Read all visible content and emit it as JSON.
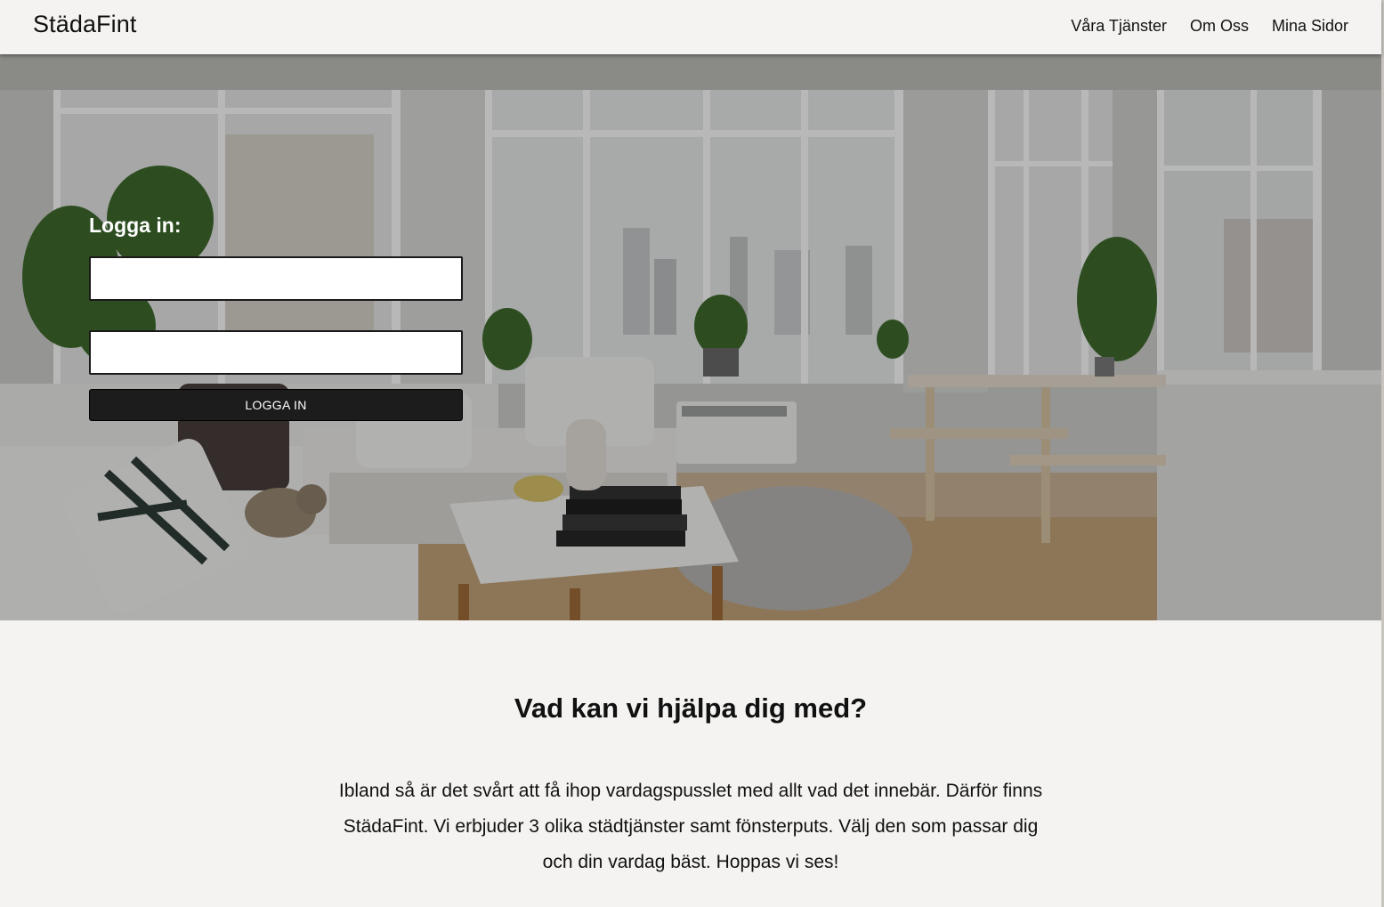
{
  "header": {
    "brand": "StädaFint",
    "nav": [
      "Våra Tjänster",
      "Om Oss",
      "Mina Sidor"
    ]
  },
  "hero": {
    "image_alt": "Bright living room with large windows, white sofa, coffee table, plants and a cat",
    "login": {
      "heading": "Logga in:",
      "username_value": "",
      "password_value": "",
      "button_label": "LOGGA IN"
    }
  },
  "content": {
    "title": "Vad kan vi hjälpa dig med?",
    "intro": "Ibland så är det svårt att få ihop vardagspusslet med allt vad det innebär. Därför finns StädaFint. Vi erbjuder 3 olika städtjänster samt fönsterputs. Välj den som passar dig och din vardag bäst. Hoppas vi ses!"
  },
  "colors": {
    "page_background": "#f4f3f1",
    "button_background": "#1c1c1c",
    "text": "#111111"
  }
}
